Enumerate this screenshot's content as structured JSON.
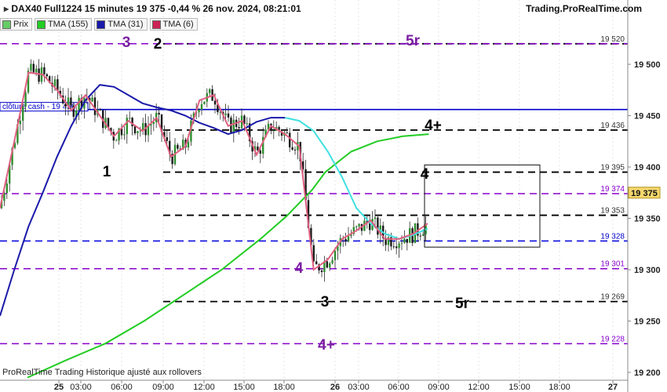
{
  "header": {
    "instrument": "DAX40 Full1224 15 minutes 19 375 -0,44 % 26 nov. 2024, 08:21:01",
    "brand": "Trading.ProRealTime.com"
  },
  "legend": [
    {
      "label": "Prix",
      "color": "#66cc66"
    },
    {
      "label": "TMA (155)",
      "color": "#22cc22"
    },
    {
      "label": "TMA (31)",
      "color": "#1a1aaa"
    },
    {
      "label": "TMA (6)",
      "color": "#cc2255"
    }
  ],
  "footer": "ProRealTime Trading Historique ajusté aux rollovers",
  "colors": {
    "price_up": "#1f7a1f",
    "price_wick": "#333333",
    "tma155": "#22cc22",
    "tma31": "#1a1aaa",
    "tma6": "#e06080",
    "tma31_tail": "#40e0e0",
    "cash": "#0000cc",
    "purple": "#8800cc",
    "black": "#000000",
    "blue_dash": "#0000dd"
  },
  "chart_data": {
    "type": "candlestick",
    "ylim": [
      19200,
      19540
    ],
    "y_ticks": [
      "19 500",
      "19 450",
      "19 400",
      "19 350",
      "19 300",
      "19 250",
      "19 200"
    ],
    "x_ticks": [
      "25",
      "03:00",
      "06:00",
      "09:00",
      "12:00",
      "15:00",
      "18:00",
      "26",
      "03:00",
      "06:00",
      "09:00",
      "12:00",
      "15:00",
      "18:00",
      "27"
    ],
    "current_price": "19 375",
    "levels": [
      {
        "value": 19520,
        "label": "19 520",
        "style": "black",
        "start": "09:00"
      },
      {
        "value": 19520,
        "label": "",
        "style": "purple",
        "start": "start"
      },
      {
        "value": 19456,
        "label": "clôture cash -  19 456",
        "style": "cash"
      },
      {
        "value": 19436,
        "label": "19 436",
        "style": "black"
      },
      {
        "value": 19395,
        "label": "19 395",
        "style": "black"
      },
      {
        "value": 19374,
        "label": "19 374",
        "style": "purple"
      },
      {
        "value": 19353,
        "label": "19 353",
        "style": "black"
      },
      {
        "value": 19328,
        "label": "19 328",
        "style": "blue"
      },
      {
        "value": 19301,
        "label": "19 301",
        "style": "purple"
      },
      {
        "value": 19269,
        "label": "19 269",
        "style": "black"
      },
      {
        "value": 19228,
        "label": "19 228",
        "style": "purple"
      }
    ],
    "annotations": [
      {
        "text": "3",
        "color": "purple"
      },
      {
        "text": "2",
        "color": "black"
      },
      {
        "text": "5r",
        "color": "purple"
      },
      {
        "text": "4+",
        "color": "black"
      },
      {
        "text": "1",
        "color": "black"
      },
      {
        "text": "4",
        "color": "black"
      },
      {
        "text": "4",
        "color": "purple"
      },
      {
        "text": "3",
        "color": "black"
      },
      {
        "text": "5r",
        "color": "black"
      },
      {
        "text": "4+",
        "color": "purple"
      }
    ],
    "box": {
      "y_top": 19402,
      "y_bottom": 19322,
      "x_start": "07:45",
      "x_end": "16:30"
    },
    "tma155": [
      [
        0,
        19195
      ],
      [
        3,
        19212
      ],
      [
        6,
        19228
      ],
      [
        9,
        19250
      ],
      [
        12,
        19275
      ],
      [
        15,
        19300
      ],
      [
        18,
        19330
      ],
      [
        20,
        19352
      ],
      [
        22,
        19378
      ],
      [
        23,
        19395
      ],
      [
        24,
        19405
      ],
      [
        25,
        19415
      ],
      [
        27,
        19425
      ],
      [
        29,
        19430
      ],
      [
        31,
        19432
      ]
    ],
    "tma31": [
      [
        0,
        19255
      ],
      [
        1,
        19300
      ],
      [
        2,
        19342
      ],
      [
        3,
        19375
      ],
      [
        4,
        19410
      ],
      [
        5,
        19440
      ],
      [
        6,
        19465
      ],
      [
        7,
        19480
      ],
      [
        8,
        19478
      ],
      [
        9,
        19470
      ],
      [
        10,
        19462
      ],
      [
        11,
        19458
      ],
      [
        12,
        19455
      ],
      [
        13,
        19450
      ],
      [
        14,
        19443
      ],
      [
        15,
        19438
      ],
      [
        16,
        19432
      ],
      [
        17,
        19436
      ],
      [
        18,
        19444
      ],
      [
        19,
        19448
      ],
      [
        20,
        19448
      ],
      [
        21,
        19445
      ],
      [
        22,
        19435
      ],
      [
        23,
        19415
      ],
      [
        24,
        19390
      ],
      [
        25,
        19360
      ],
      [
        26,
        19345
      ],
      [
        27,
        19335
      ],
      [
        28,
        19330
      ],
      [
        29,
        19334
      ],
      [
        30,
        19340
      ]
    ],
    "tma6": [
      [
        0,
        19360
      ],
      [
        1,
        19425
      ],
      [
        2,
        19492
      ],
      [
        3,
        19490
      ],
      [
        4,
        19475
      ],
      [
        5,
        19455
      ],
      [
        6,
        19470
      ],
      [
        7,
        19450
      ],
      [
        8,
        19430
      ],
      [
        9,
        19445
      ],
      [
        10,
        19435
      ],
      [
        11,
        19448
      ],
      [
        12,
        19410
      ],
      [
        13,
        19420
      ],
      [
        14,
        19465
      ],
      [
        15,
        19470
      ],
      [
        16,
        19440
      ],
      [
        17,
        19445
      ],
      [
        18,
        19412
      ],
      [
        19,
        19440
      ],
      [
        20,
        19432
      ],
      [
        21,
        19420
      ],
      [
        22,
        19300
      ],
      [
        23,
        19310
      ],
      [
        24,
        19330
      ],
      [
        25,
        19338
      ],
      [
        26,
        19348
      ],
      [
        27,
        19330
      ],
      [
        28,
        19330
      ],
      [
        29,
        19335
      ],
      [
        30,
        19345
      ]
    ]
  }
}
